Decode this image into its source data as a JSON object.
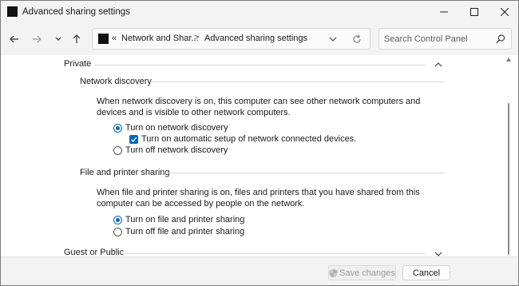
{
  "window": {
    "title": "Advanced sharing settings"
  },
  "address": {
    "separator": "«",
    "crumbs": [
      "Network and Shar...",
      "Advanced sharing settings"
    ],
    "crumb_separator": ">"
  },
  "search": {
    "placeholder": "Search Control Panel"
  },
  "private": {
    "header": "Private",
    "network_discovery": {
      "heading": "Network discovery",
      "description": "When network discovery is on, this computer can see other network computers and devices and is visible to other network computers.",
      "options": [
        {
          "label": "Turn on network discovery",
          "selected": true
        },
        {
          "label": "Turn off network discovery",
          "selected": false
        }
      ],
      "auto_setup": {
        "label": "Turn on automatic setup of network connected devices.",
        "checked": true
      }
    },
    "file_sharing": {
      "heading": "File and printer sharing",
      "description": "When file and printer sharing is on, files and printers that you have shared from this computer can be accessed by people on the network.",
      "options": [
        {
          "label": "Turn on file and printer sharing",
          "selected": true
        },
        {
          "label": "Turn off file and printer sharing",
          "selected": false
        }
      ]
    }
  },
  "guest_public": {
    "header": "Guest or Public"
  },
  "footer": {
    "save_label": "Save changes",
    "cancel_label": "Cancel"
  },
  "colors": {
    "accent": "#0067c0"
  }
}
